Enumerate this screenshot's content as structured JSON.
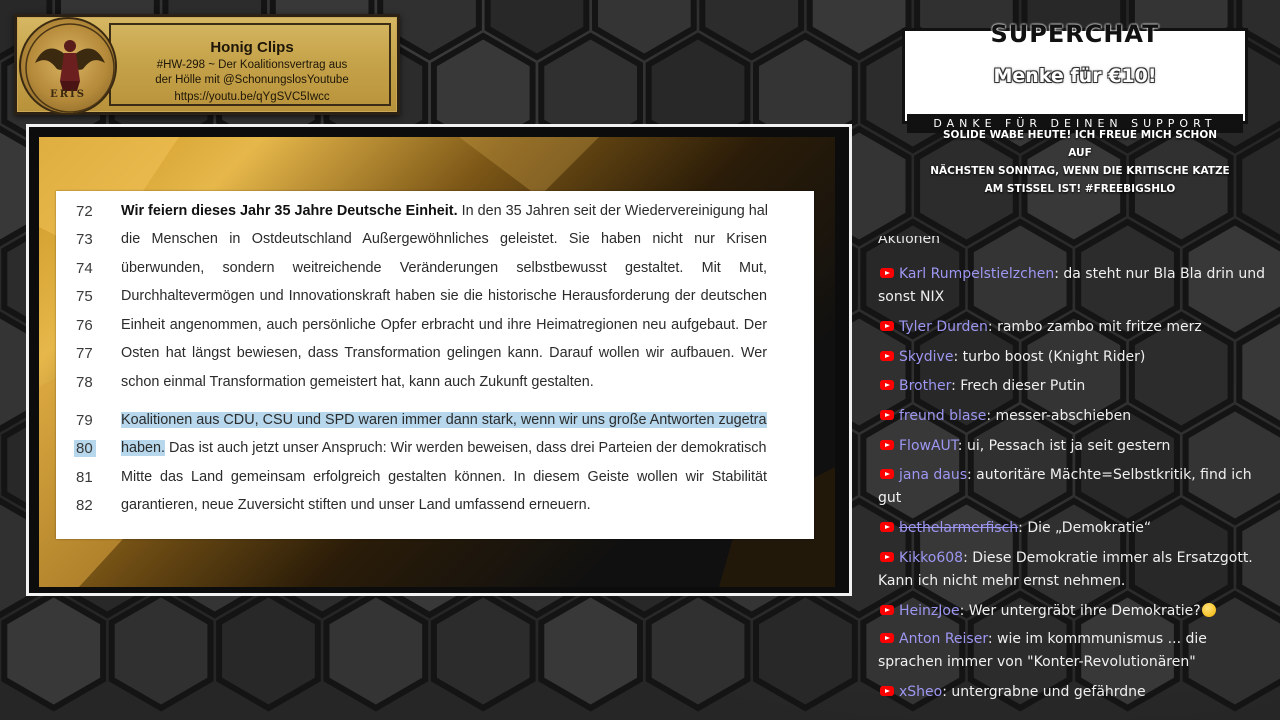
{
  "clip_banner": {
    "logo_text": "ERIS",
    "title": "Honig Clips",
    "subtitle_line1": "#HW-298 ~ Der Koalitionsvertrag aus",
    "subtitle_line2": "der Hölle mit @SchonungslosYoutube",
    "url": "https://youtu.be/qYgSVC5Iwcc"
  },
  "document": {
    "lines": [
      {
        "num": "72",
        "bold": "Wir feiern dieses Jahr 35 Jahre Deutsche Einheit.",
        "text": " In den 35 Jahren seit der Wiedervereinigung haben"
      },
      {
        "num": "73",
        "text": "die Menschen in Ostdeutschland Außergewöhnliches geleistet. Sie haben nicht nur Krisen"
      },
      {
        "num": "74",
        "text": "überwunden, sondern weitreichende Veränderungen selbstbewusst gestaltet. Mit Mut,"
      },
      {
        "num": "75",
        "text": "Durchhaltevermögen und Innovationskraft haben sie die historische Herausforderung der deutschen"
      },
      {
        "num": "76",
        "text": "Einheit angenommen, auch persönliche Opfer erbracht und ihre Heimatregionen neu aufgebaut. Der"
      },
      {
        "num": "77",
        "text": "Osten hat längst bewiesen, dass Transformation gelingen kann. Darauf wollen wir aufbauen. Wer"
      },
      {
        "num": "78",
        "text": "schon einmal Transformation gemeistert hat, kann auch Zukunft gestalten."
      },
      {
        "num": "79",
        "highlight": "Koalitionen aus CDU, CSU und SPD waren immer dann stark, wenn wir uns große Antworten zugetraut"
      },
      {
        "num": "80",
        "highlight": "haben.",
        "text": " Das ist auch jetzt unser Anspruch: Wir werden beweisen, dass drei Parteien der demokratischen"
      },
      {
        "num": "81",
        "text": "Mitte das Land gemeinsam erfolgreich gestalten können. In diesem Geiste wollen wir Stabilität"
      },
      {
        "num": "82",
        "text": "garantieren, neue Zuversicht stiften und unser Land umfassend erneuern."
      }
    ],
    "highlight_color": "#b7d7ec"
  },
  "superchat": {
    "title": "SUPERCHAT",
    "message": "Menke für €10!",
    "bar": "DANKE FÜR DEINEN SUPPORT",
    "note_line1": "Solide Wabe heute! Ich freue mich schon auf",
    "note_line2": "nächsten Sonntag, wenn die kritische Katze",
    "note_line3": "am Stissel ist! #FreeBigShlo"
  },
  "chat": {
    "cut_text": "Aktionen",
    "author_color": "#9d97f2",
    "messages": [
      {
        "author": "Karl Rumpelstielzchen",
        "text": "da steht nur Bla Bla drin und sonst NIX"
      },
      {
        "author": "Tyler Durden",
        "text": "rambo zambo mit fritze merz"
      },
      {
        "author": "Skydive",
        "text": "turbo boost (Knight Rider)"
      },
      {
        "author": "Brother",
        "text": "Frech dieser Putin"
      },
      {
        "author": "freund blase",
        "text": "messer-abschieben"
      },
      {
        "author": "FlowAUT",
        "text": "ui, Pessach ist ja seit gestern"
      },
      {
        "author": "jana daus",
        "text": "autoritäre Mächte=Selbstkritik, find ich gut"
      },
      {
        "author": "bethelarmerfisch",
        "text": "Die „Demokratie“"
      },
      {
        "author": "Kikko608",
        "text": "Diese Demokratie immer als Ersatzgott. Kann ich nicht mehr ernst nehmen."
      },
      {
        "author": "HeinzJoe",
        "text": "Wer untergräbt ihre Demokratie?"
      },
      {
        "author": "Anton Reiser",
        "text": "wie im kommmunismus ... die sprachen immer von \"Konter-Revolutionären\""
      },
      {
        "author": "xSheo",
        "text": "untergrabne und gefährdne"
      }
    ]
  }
}
